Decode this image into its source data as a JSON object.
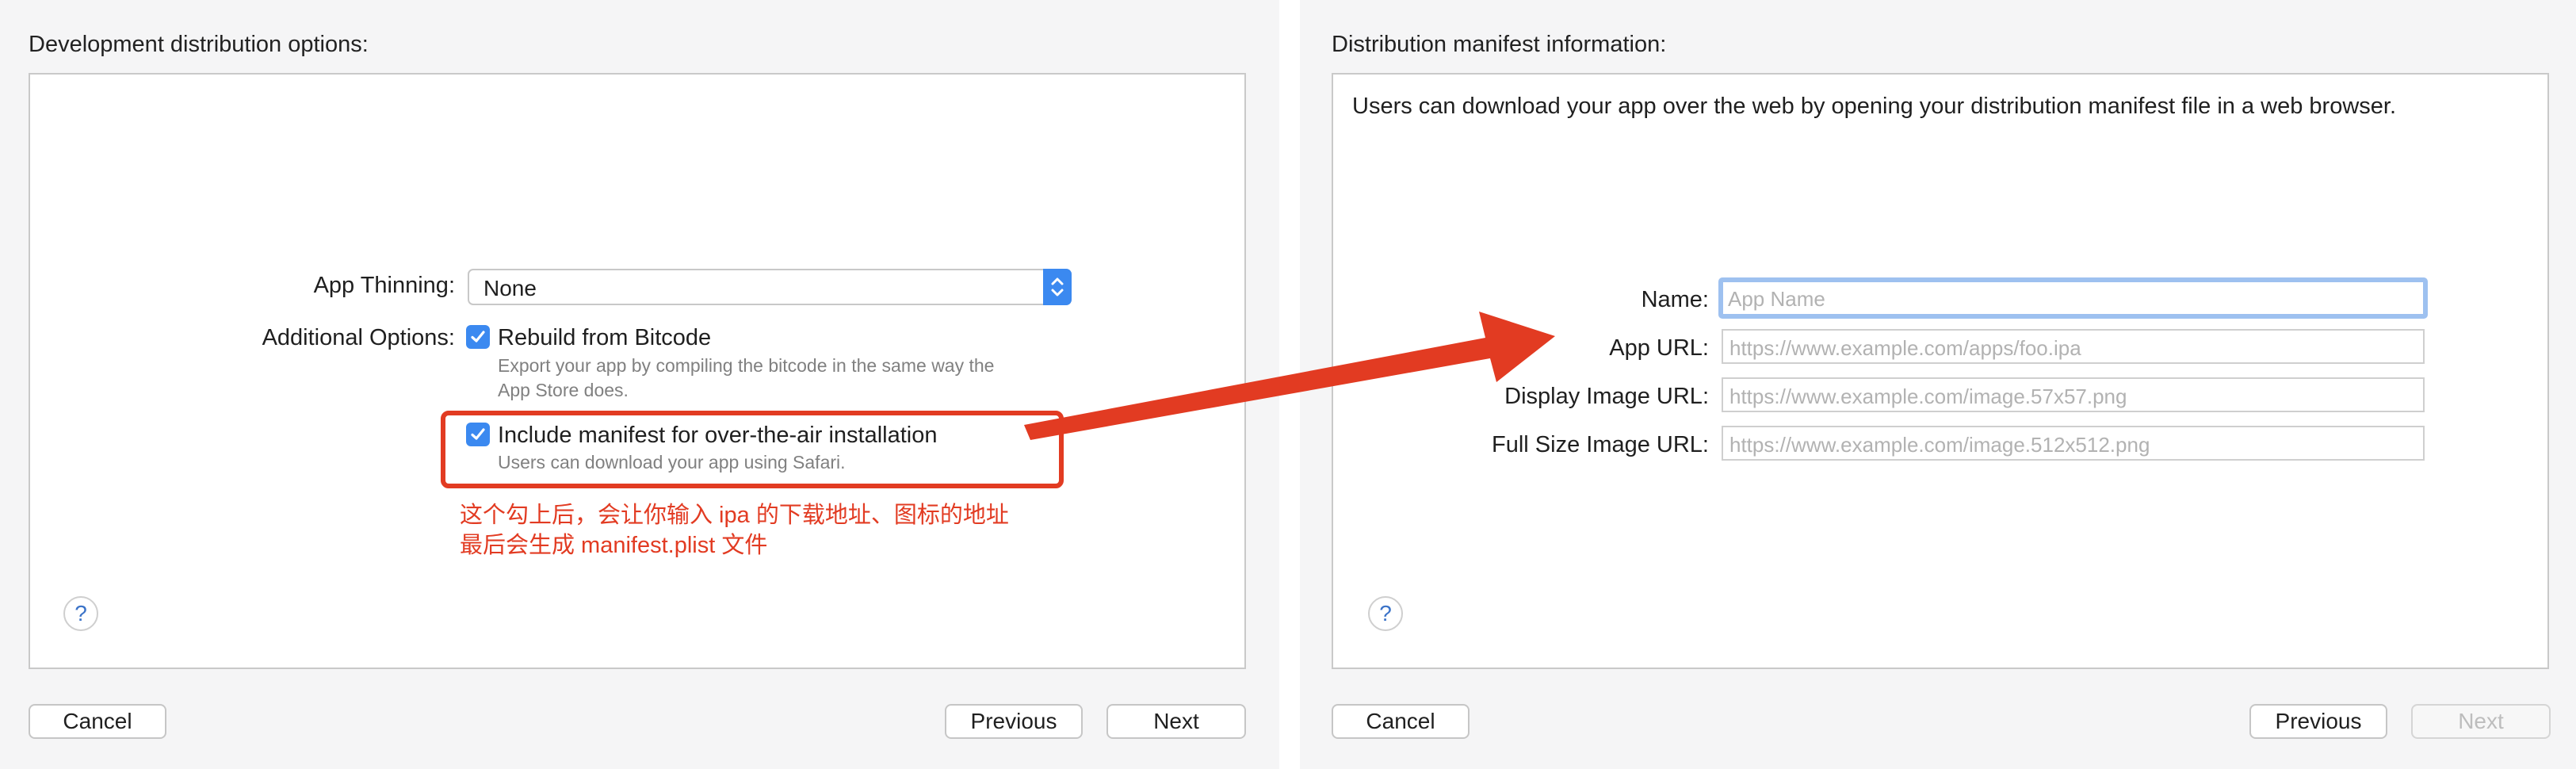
{
  "left": {
    "section_title": "Development distribution options:",
    "app_thinning": {
      "label": "App Thinning:",
      "value": "None"
    },
    "additional_options_label": "Additional Options:",
    "rebuild": {
      "title": "Rebuild from Bitcode",
      "desc_line1": "Export your app by compiling the bitcode in the same way the",
      "desc_line2": "App Store does.",
      "checked": true
    },
    "manifest": {
      "title": "Include manifest for over-the-air installation",
      "desc": "Users can download your app using Safari.",
      "checked": true
    },
    "annotation_line1": "这个勾上后，会让你输入 ipa 的下载地址、图标的地址",
    "annotation_line2": "最后会生成 manifest.plist 文件",
    "help": "?",
    "buttons": {
      "cancel": "Cancel",
      "previous": "Previous",
      "next": "Next"
    }
  },
  "right": {
    "section_title": "Distribution manifest information:",
    "intro": "Users can download your app over the web by opening your distribution manifest file in a web browser.",
    "fields": [
      {
        "label": "Name:",
        "placeholder": "App Name"
      },
      {
        "label": "App URL:",
        "placeholder": "https://www.example.com/apps/foo.ipa"
      },
      {
        "label": "Display Image URL:",
        "placeholder": "https://www.example.com/image.57x57.png"
      },
      {
        "label": "Full Size Image URL:",
        "placeholder": "https://www.example.com/image.512x512.png"
      }
    ],
    "help": "?",
    "buttons": {
      "cancel": "Cancel",
      "previous": "Previous",
      "next": "Next"
    }
  },
  "colors": {
    "accent": "#3b89f0",
    "annotation": "#e23b22",
    "focus_ring": "#9ec1f0"
  },
  "icons": {
    "select_stepper": "chevron-up-down-icon",
    "checkbox": "checkmark-icon",
    "help": "question-mark-icon",
    "arrow": "red-arrow-annotation"
  }
}
